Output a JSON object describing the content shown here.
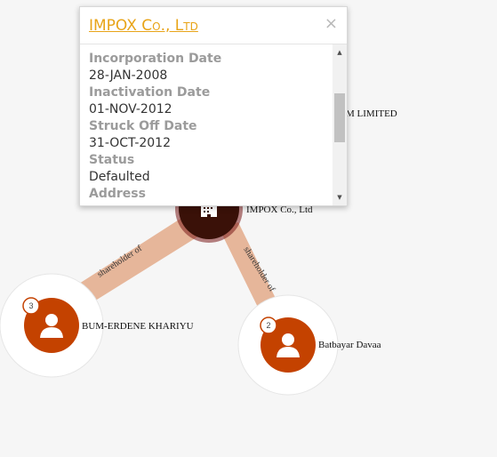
{
  "graph": {
    "edges": [
      {
        "label": "shareholder of"
      },
      {
        "label": "shareholder of"
      }
    ],
    "nodes": {
      "company": {
        "label": "IMPOX Co., Ltd",
        "icon": "building-icon"
      },
      "partial_company": {
        "label": "M LIMITED"
      },
      "person_left": {
        "label": "BUM-ERDENE KHARIYU",
        "badge": "3",
        "icon": "person-icon"
      },
      "person_right": {
        "label": "Batbayar Davaa",
        "badge": "2",
        "icon": "person-icon"
      }
    }
  },
  "popup": {
    "title": "IMPOX Co., Ltd",
    "close_icon": "×",
    "fields": [
      {
        "label": "Incorporation Date",
        "value": "28-JAN-2008"
      },
      {
        "label": "Inactivation Date",
        "value": "01-NOV-2012"
      },
      {
        "label": "Struck Off Date",
        "value": "31-OCT-2012"
      },
      {
        "label": "Status",
        "value": "Defaulted"
      },
      {
        "label": "Address",
        "value": ""
      }
    ]
  },
  "colors": {
    "node_orange": "#c44200",
    "company_dark": "#3a1108",
    "edge": "#e6b69a",
    "link": "#e8a418"
  }
}
